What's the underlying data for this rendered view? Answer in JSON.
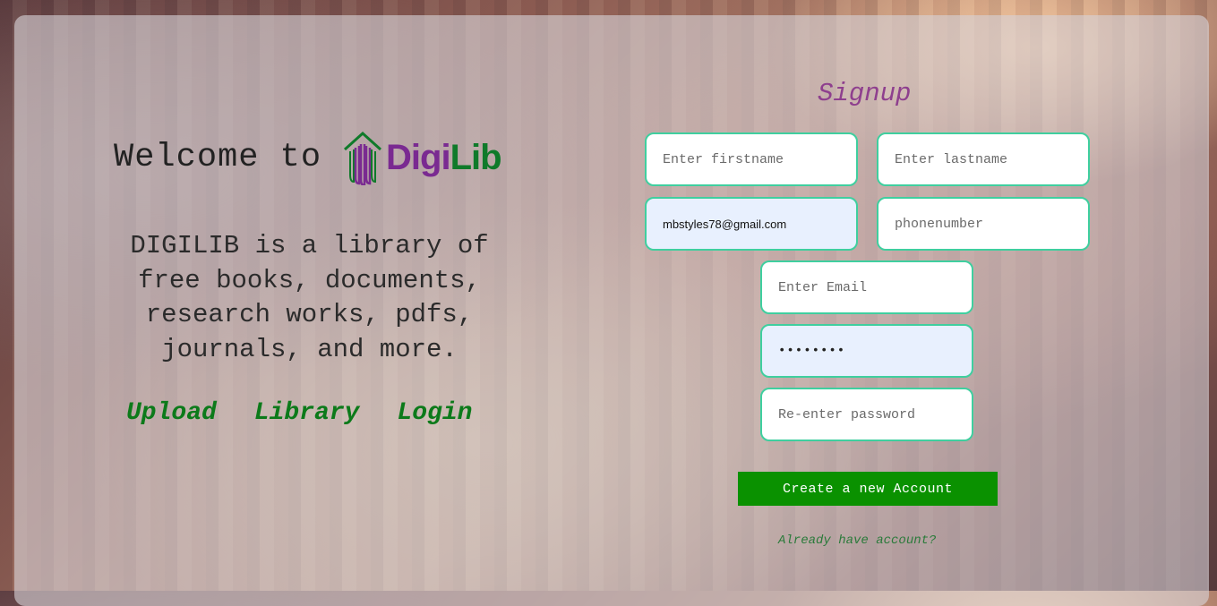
{
  "welcome": {
    "text": "Welcome to",
    "logo_part1": "Digi",
    "logo_part2": "Lib"
  },
  "description": "DIGILIB is a library of free books, documents, research works, pdfs, journals, and more.",
  "nav": {
    "upload": "Upload",
    "library": "Library",
    "login": "Login"
  },
  "signup": {
    "title": "Signup",
    "firstname_placeholder": "Enter firstname",
    "lastname_placeholder": "Enter lastname",
    "username_value": "mbstyles78@gmail.com",
    "phone_placeholder": "phonenumber",
    "email_placeholder": "Enter Email",
    "password_value": "••••••••",
    "repassword_placeholder": "Re-enter password",
    "create_button": "Create a new Account",
    "already_link": "Already have account?"
  },
  "colors": {
    "brand_purple": "#7a2a91",
    "brand_green": "#0f7a2a",
    "button_green": "#0a9100",
    "field_border": "#3fcf9f",
    "signup_title": "#8e3f8e"
  }
}
